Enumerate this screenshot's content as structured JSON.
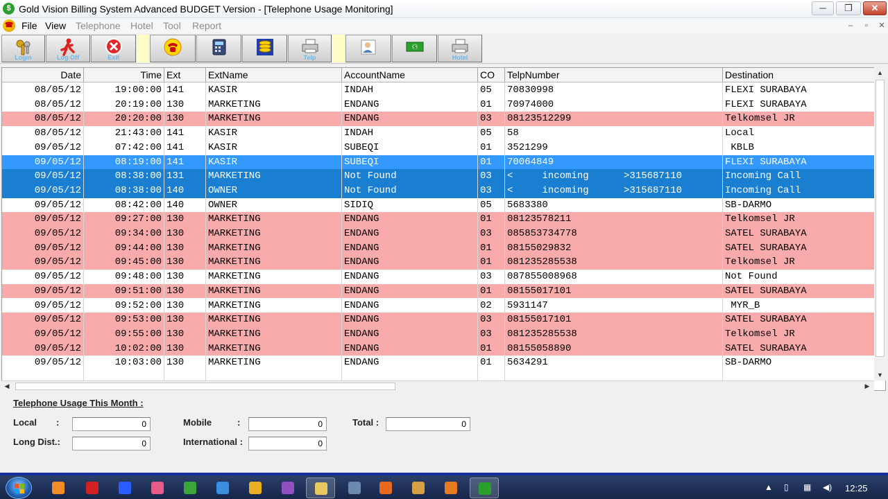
{
  "window": {
    "title": "Gold Vision Billing System Advanced BUDGET Version - [Telephone Usage Monitoring]",
    "app_icon": "dollar-icon",
    "controls": {
      "minimize": "─",
      "restore": "❐",
      "close": "✕"
    }
  },
  "menu": {
    "items": [
      {
        "label": "File",
        "enabled": true
      },
      {
        "label": "View",
        "enabled": true
      },
      {
        "label": "Telephone",
        "enabled": false
      },
      {
        "label": "Hotel",
        "enabled": false
      },
      {
        "label": "Tool",
        "enabled": false
      },
      {
        "label": "Report",
        "enabled": false
      }
    ],
    "mdi_controls": {
      "minimize": "–",
      "restore": "▫",
      "close": "✕"
    }
  },
  "toolbar": {
    "buttons": [
      {
        "name": "login",
        "label": "Login",
        "icon": "keys-icon"
      },
      {
        "name": "logoff",
        "label": "Log Off",
        "icon": "running-man-icon"
      },
      {
        "name": "exit",
        "label": "Exit",
        "icon": "exit-icon"
      },
      {
        "name": "phone",
        "label": "",
        "icon": "telephone-icon"
      },
      {
        "name": "calculator",
        "label": "",
        "icon": "calculator-icon"
      },
      {
        "name": "database",
        "label": "",
        "icon": "database-icon"
      },
      {
        "name": "print-telp",
        "label": "Telp",
        "icon": "printer-icon"
      },
      {
        "name": "user",
        "label": "",
        "icon": "user-card-icon"
      },
      {
        "name": "money",
        "label": "",
        "icon": "money-icon"
      },
      {
        "name": "print-hotel",
        "label": "Hotel",
        "icon": "printer-icon"
      }
    ]
  },
  "grid": {
    "columns": [
      "Date",
      "Time",
      "Ext",
      "ExtName",
      "AccountName",
      "CO",
      "TelpNumber",
      "Destination"
    ],
    "rows": [
      {
        "style": "white",
        "cells": [
          "08/05/12",
          "19:00:00",
          "141",
          "KASIR",
          "INDAH",
          "05",
          "70830998",
          "FLEXI SURABAYA"
        ]
      },
      {
        "style": "white",
        "cells": [
          "08/05/12",
          "20:19:00",
          "130",
          "MARKETING",
          "ENDANG",
          "01",
          "70974000",
          "FLEXI SURABAYA"
        ]
      },
      {
        "style": "pink",
        "cells": [
          "08/05/12",
          "20:20:00",
          "130",
          "MARKETING",
          "ENDANG",
          "03",
          "08123512299",
          "Telkomsel JR"
        ]
      },
      {
        "style": "white",
        "cells": [
          "08/05/12",
          "21:43:00",
          "141",
          "KASIR",
          "INDAH",
          "05",
          "58",
          "Local"
        ]
      },
      {
        "style": "white",
        "cells": [
          "09/05/12",
          "07:42:00",
          "141",
          "KASIR",
          "SUBEQI",
          "01",
          "3521299",
          " KBLB"
        ]
      },
      {
        "style": "sel",
        "cells": [
          "09/05/12",
          "08:19:00",
          "141",
          "KASIR",
          "SUBEQI",
          "01",
          "70064849",
          "FLEXI SURABAYA"
        ]
      },
      {
        "style": "sel2",
        "cells": [
          "09/05/12",
          "08:38:00",
          "131",
          "MARKETING",
          "Not Found",
          "03",
          "<     incoming      >315687110",
          "Incoming Call"
        ]
      },
      {
        "style": "sel2",
        "cells": [
          "09/05/12",
          "08:38:00",
          "140",
          "OWNER",
          "Not Found",
          "03",
          "<     incoming      >315687110",
          "Incoming Call"
        ]
      },
      {
        "style": "white",
        "cells": [
          "09/05/12",
          "08:42:00",
          "140",
          "OWNER",
          "SIDIQ",
          "05",
          "5683380",
          "SB-DARMO"
        ]
      },
      {
        "style": "pink",
        "cells": [
          "09/05/12",
          "09:27:00",
          "130",
          "MARKETING",
          "ENDANG",
          "01",
          "08123578211",
          "Telkomsel JR"
        ]
      },
      {
        "style": "pink",
        "cells": [
          "09/05/12",
          "09:34:00",
          "130",
          "MARKETING",
          "ENDANG",
          "03",
          "085853734778",
          "SATEL SURABAYA"
        ]
      },
      {
        "style": "pink",
        "cells": [
          "09/05/12",
          "09:44:00",
          "130",
          "MARKETING",
          "ENDANG",
          "01",
          "08155029832",
          "SATEL SURABAYA"
        ]
      },
      {
        "style": "pink",
        "cells": [
          "09/05/12",
          "09:45:00",
          "130",
          "MARKETING",
          "ENDANG",
          "01",
          "081235285538",
          "Telkomsel JR"
        ]
      },
      {
        "style": "white",
        "cells": [
          "09/05/12",
          "09:48:00",
          "130",
          "MARKETING",
          "ENDANG",
          "03",
          "087855008968",
          "Not Found"
        ]
      },
      {
        "style": "pink",
        "cells": [
          "09/05/12",
          "09:51:00",
          "130",
          "MARKETING",
          "ENDANG",
          "01",
          "08155017101",
          "SATEL SURABAYA"
        ]
      },
      {
        "style": "white",
        "cells": [
          "09/05/12",
          "09:52:00",
          "130",
          "MARKETING",
          "ENDANG",
          "02",
          "5931147",
          " MYR_B"
        ]
      },
      {
        "style": "pink",
        "cells": [
          "09/05/12",
          "09:53:00",
          "130",
          "MARKETING",
          "ENDANG",
          "03",
          "08155017101",
          "SATEL SURABAYA"
        ]
      },
      {
        "style": "pink",
        "cells": [
          "09/05/12",
          "09:55:00",
          "130",
          "MARKETING",
          "ENDANG",
          "03",
          "081235285538",
          "Telkomsel JR"
        ]
      },
      {
        "style": "pink",
        "cells": [
          "09/05/12",
          "10:02:00",
          "130",
          "MARKETING",
          "ENDANG",
          "01",
          "08155058890",
          "SATEL SURABAYA"
        ]
      },
      {
        "style": "white",
        "cells": [
          "09/05/12",
          "10:03:00",
          "130",
          "MARKETING",
          "ENDANG",
          "01",
          "5634291",
          "SB-DARMO"
        ]
      }
    ]
  },
  "summary": {
    "heading": "Telephone Usage This Month :",
    "local_label": "Local",
    "local_colon": ":",
    "local_value": "0",
    "longdist_label": "Long Dist.:",
    "longdist_value": "0",
    "mobile_label": "Mobile",
    "mobile_colon": ":",
    "mobile_value": "0",
    "international_label": "International :",
    "international_value": "0",
    "total_label": "Total :",
    "total_value": "0"
  },
  "taskbar": {
    "apps": [
      {
        "name": "media-player",
        "color": "#f28c28"
      },
      {
        "name": "acrobat",
        "color": "#d32020"
      },
      {
        "name": "plus-app",
        "color": "#2a5cff"
      },
      {
        "name": "paint",
        "color": "#e85a8a"
      },
      {
        "name": "utorrent",
        "color": "#3aa63a"
      },
      {
        "name": "internet-explorer",
        "color": "#3b8de0"
      },
      {
        "name": "chrome",
        "color": "#e8b020"
      },
      {
        "name": "messenger",
        "color": "#9050c0"
      },
      {
        "name": "file-explorer",
        "color": "#e8c860"
      },
      {
        "name": "network-app",
        "color": "#6a8ab0"
      },
      {
        "name": "firefox",
        "color": "#e86a20"
      },
      {
        "name": "tools-app",
        "color": "#d8a040"
      },
      {
        "name": "office-app",
        "color": "#e87a20"
      },
      {
        "name": "gold-vision",
        "color": "#2ca02c"
      }
    ],
    "clock": "12:25"
  }
}
